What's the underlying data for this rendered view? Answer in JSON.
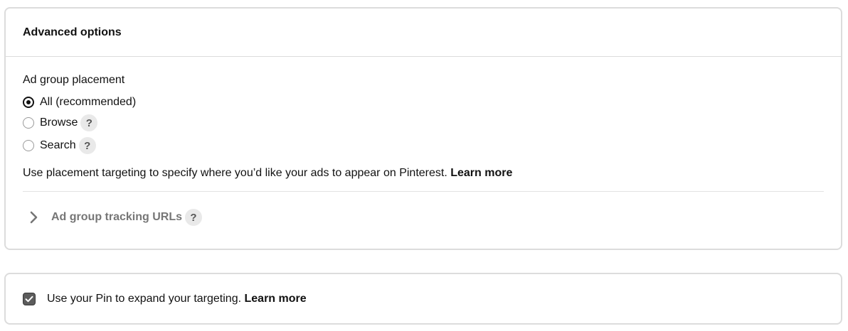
{
  "advanced": {
    "title": "Advanced options",
    "placement_label": "Ad group placement",
    "options": [
      {
        "label": "All (recommended)",
        "selected": true,
        "help": false
      },
      {
        "label": "Browse",
        "selected": false,
        "help": true
      },
      {
        "label": "Search",
        "selected": false,
        "help": true
      }
    ],
    "help_glyph": "?",
    "description": "Use placement targeting to specify where you’d like your ads to appear on Pinterest.",
    "learn_more": "Learn more",
    "tracking_label": "Ad group tracking URLs",
    "tracking_icon": "chevron-right-icon"
  },
  "expand": {
    "checked": true,
    "text": "Use your Pin to expand your targeting.",
    "learn_more": "Learn more"
  },
  "colors": {
    "border": "#dcdcdc",
    "text": "#111111",
    "muted": "#767676",
    "help_bg": "#e9e9e9",
    "checkbox_bg": "#5c5c5c"
  }
}
